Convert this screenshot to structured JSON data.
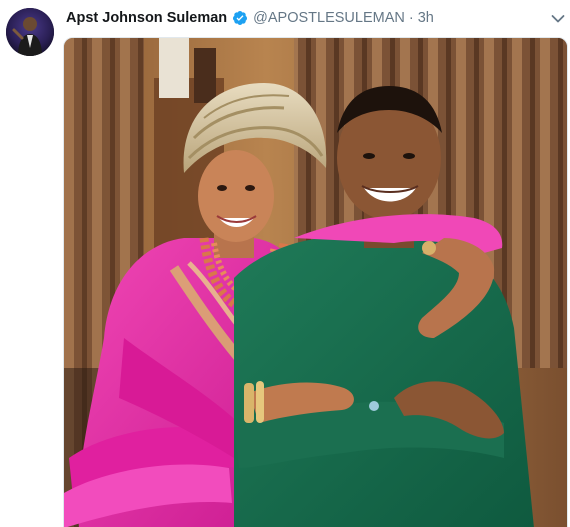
{
  "tweet": {
    "author_name": "Apst Johnson Suleman",
    "handle": "@APOSTLESULEMAN",
    "separator": "·",
    "time": "3h",
    "verified": true,
    "avatar_icon": "profile-photo",
    "menu_icon": "chevron-down-icon",
    "photo_description_icon": "photo-couple"
  },
  "colors": {
    "name_text": "#14171a",
    "meta_text": "#657786",
    "verified_blue": "#1da1f2",
    "caret": "#657786",
    "border": "#e1e8ed"
  }
}
